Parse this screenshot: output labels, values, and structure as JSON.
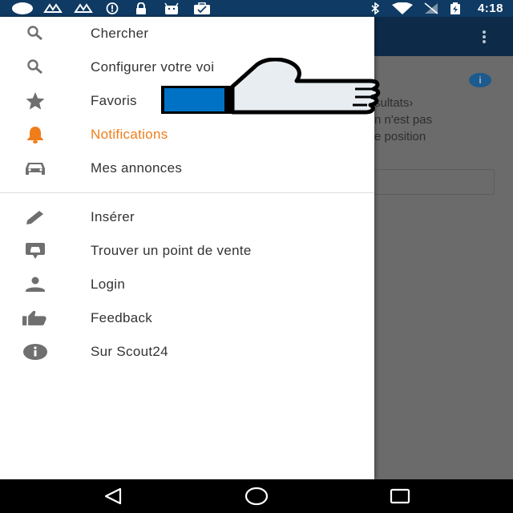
{
  "status_bar": {
    "time": "4:18",
    "icons": [
      "circle-notification-icon",
      "signal-icon",
      "signal-icon",
      "alert-icon",
      "lock-icon",
      "android-icon",
      "briefcase-icon",
      "bluetooth-icon",
      "wifi-icon",
      "no-sim-icon",
      "battery-icon"
    ]
  },
  "app_behind": {
    "text_lines": [
      "sultats›",
      "n n'est pas",
      "e position"
    ]
  },
  "drawer": {
    "items": [
      {
        "label": "Chercher",
        "icon": "search-icon"
      },
      {
        "label": "Configurer votre voi",
        "icon": "search-icon"
      },
      {
        "label": "Favoris",
        "icon": "star-icon"
      },
      {
        "label": "Notifications",
        "icon": "bell-icon",
        "active": true
      },
      {
        "label": "Mes annonces",
        "icon": "car-icon"
      },
      {
        "label": "Insérer",
        "icon": "pencil-icon"
      },
      {
        "label": "Trouver un point de vente",
        "icon": "dealer-icon"
      },
      {
        "label": "Login",
        "icon": "person-icon"
      },
      {
        "label": "Feedback",
        "icon": "thumbs-up-icon"
      },
      {
        "label": "Sur Scout24",
        "icon": "info-icon"
      }
    ]
  },
  "colors": {
    "active": "#f07d1a",
    "icon": "#6f6f6f",
    "toolbar": "#0d2b49",
    "status_bar": "#0f3a63",
    "thumb_cuff": "#0072c6"
  },
  "nav_bar": {
    "buttons": [
      "back-icon",
      "home-icon",
      "recents-icon"
    ]
  }
}
